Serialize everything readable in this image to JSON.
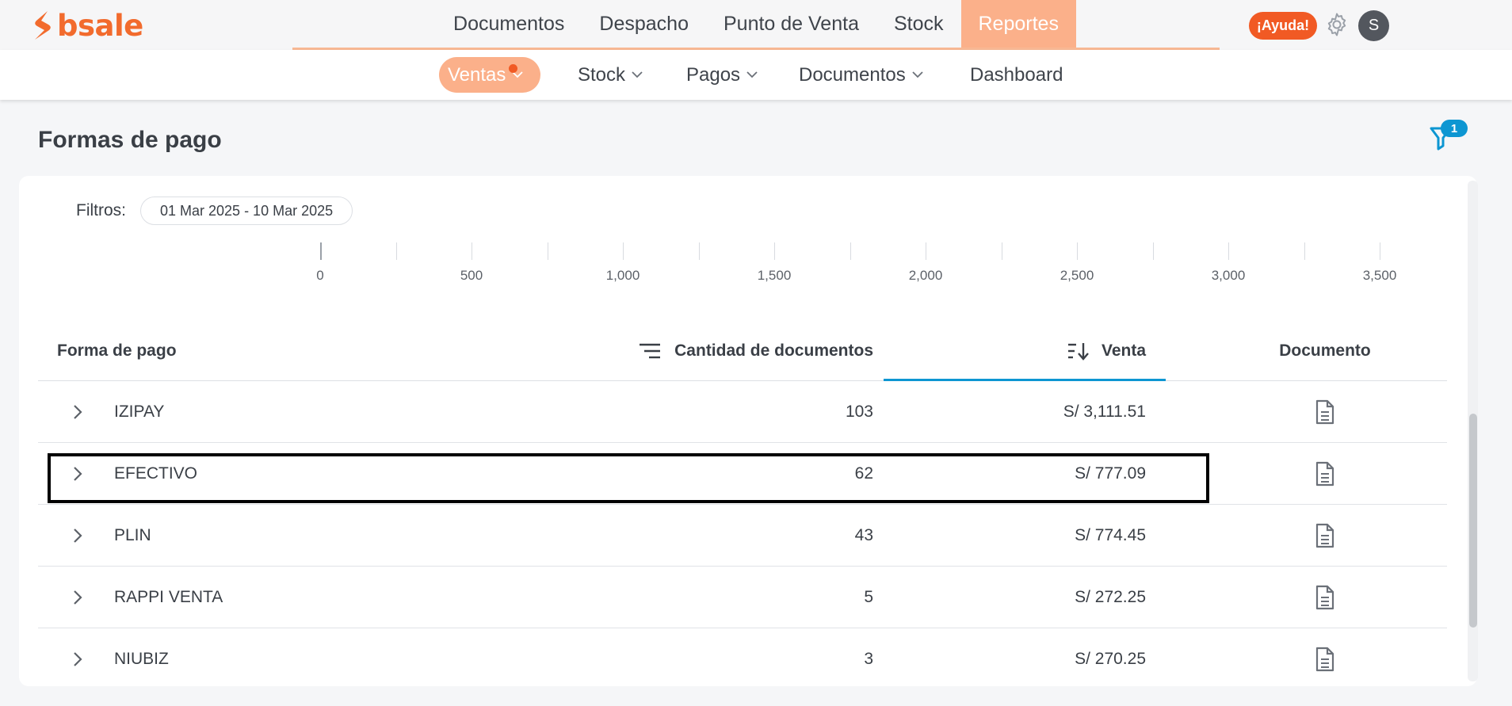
{
  "brand": {
    "name": "bsale",
    "color": "#f26b2d"
  },
  "main_nav": [
    {
      "label": "Documentos",
      "active": false
    },
    {
      "label": "Despacho",
      "active": false
    },
    {
      "label": "Punto de Venta",
      "active": false
    },
    {
      "label": "Stock",
      "active": false
    },
    {
      "label": "Reportes",
      "active": true
    }
  ],
  "header": {
    "help_label": "¡Ayuda!",
    "settings_icon": "gear-icon",
    "avatar_initial": "S"
  },
  "sub_nav": [
    {
      "label": "Ventas",
      "active": true,
      "has_dropdown": true,
      "has_notification_dot": true
    },
    {
      "label": "Stock",
      "active": false,
      "has_dropdown": true
    },
    {
      "label": "Pagos",
      "active": false,
      "has_dropdown": true
    },
    {
      "label": "Documentos",
      "active": false,
      "has_dropdown": true
    },
    {
      "label": "Dashboard",
      "active": false,
      "has_dropdown": false
    }
  ],
  "page": {
    "title": "Formas de pago",
    "filter_count": "1"
  },
  "filters": {
    "label": "Filtros:",
    "date_range": "01 Mar 2025 - 10 Mar 2025"
  },
  "axis": {
    "ticks": [
      "0",
      "500",
      "1,000",
      "1,500",
      "2,000",
      "2,500",
      "3,000",
      "3,500"
    ]
  },
  "table": {
    "columns": {
      "forma": "Forma de pago",
      "cantidad": "Cantidad de documentos",
      "venta": "Venta",
      "documento": "Documento"
    },
    "sorted_column": "Venta",
    "rows": [
      {
        "name": "IZIPAY",
        "qty": "103",
        "sale": "S/ 3,111.51"
      },
      {
        "name": "EFECTIVO",
        "qty": "62",
        "sale": "S/ 777.09"
      },
      {
        "name": "PLIN",
        "qty": "43",
        "sale": "S/ 774.45"
      },
      {
        "name": "RAPPI VENTA",
        "qty": "5",
        "sale": "S/ 272.25"
      },
      {
        "name": "NIUBIZ",
        "qty": "3",
        "sale": "S/ 270.25"
      }
    ]
  },
  "colors": {
    "accent": "#fbb08a",
    "orange": "#f15a24",
    "blue": "#0d96d2"
  }
}
